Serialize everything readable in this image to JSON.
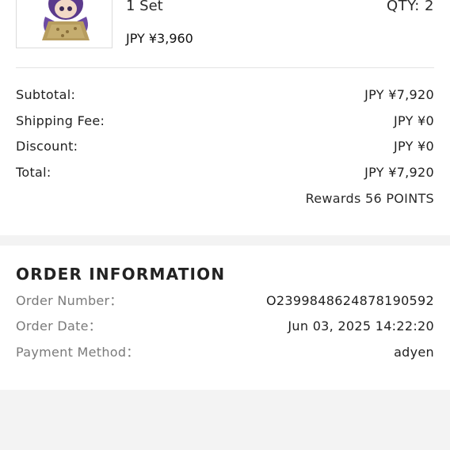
{
  "item": {
    "variant": "1 Set",
    "qty": "QTY: 2",
    "price": "JPY ¥3,960",
    "image_icon": "plush-figure-image"
  },
  "summary": {
    "subtotal_label": "Subtotal:",
    "subtotal_value": "JPY ¥7,920",
    "shipping_label": "Shipping Fee:",
    "shipping_value": "JPY ¥0",
    "discount_label": "Discount:",
    "discount_value": "JPY ¥0",
    "total_label": "Total:",
    "total_value": "JPY ¥7,920",
    "rewards": "Rewards 56 POINTS"
  },
  "order_info": {
    "title": "ORDER INFORMATION",
    "order_number_label": "Order Number：",
    "order_number_value": "O2399848624878190592",
    "order_date_label": "Order Date：",
    "order_date_value": "Jun 03, 2025 14:22:20",
    "payment_method_label": "Payment Method：",
    "payment_method_value": "adyen"
  },
  "colors": {
    "background": "#f3f3f3",
    "card": "#ffffff",
    "label_muted": "#7a7a7a"
  }
}
